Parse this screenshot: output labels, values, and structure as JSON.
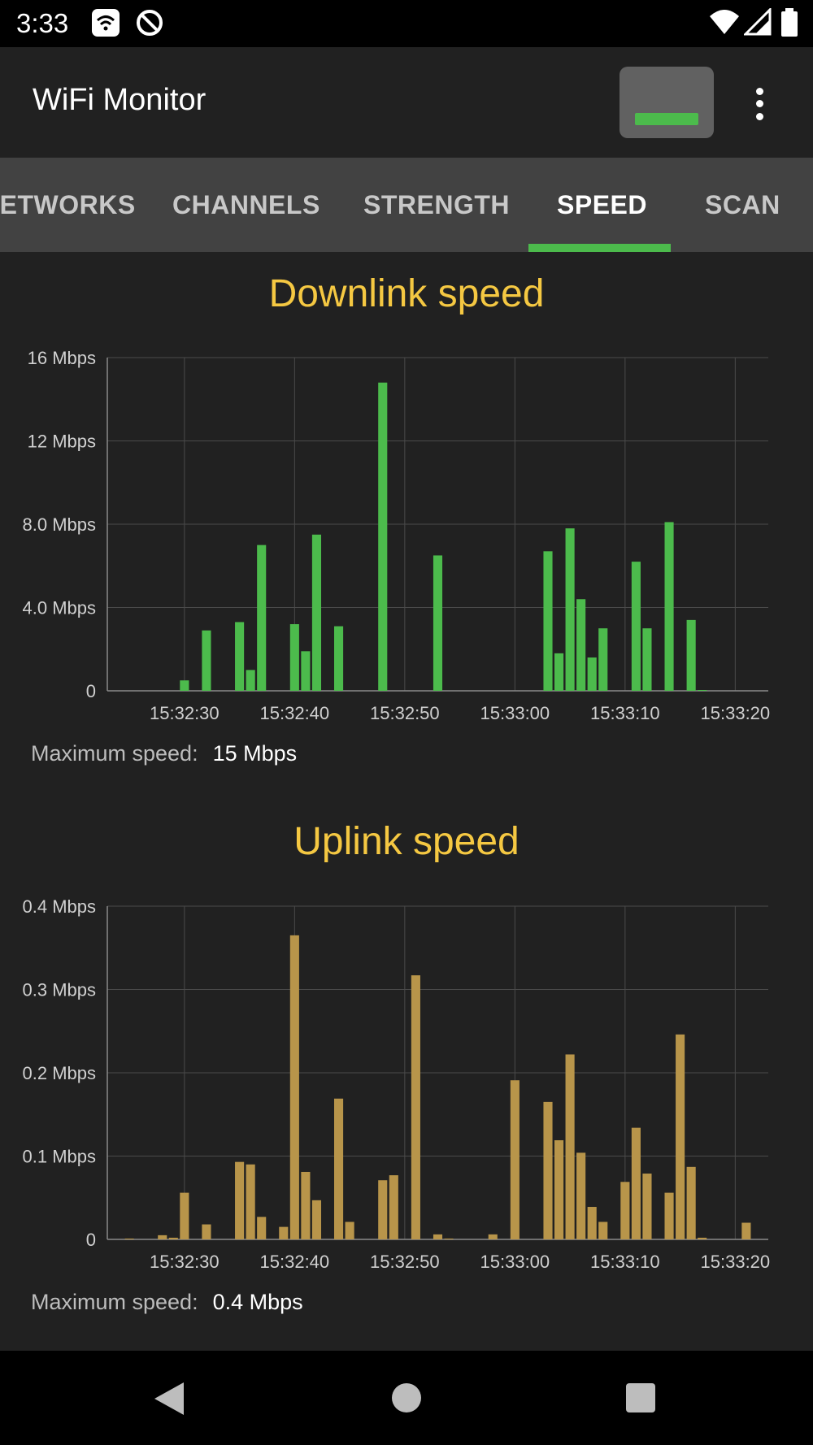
{
  "status_bar": {
    "time": "3:33",
    "left_icons": [
      "wifi-monitor-notification-icon",
      "do-not-disturb-icon"
    ],
    "right_icons": [
      "wifi-signal-icon",
      "cell-signal-icon",
      "battery-icon"
    ]
  },
  "app_bar": {
    "title": "WiFi Monitor",
    "status_button_icon": "connection-status-icon",
    "menu_icon": "more-vert-icon"
  },
  "tabs": [
    {
      "label": "NETWORKS",
      "active": false
    },
    {
      "label": "CHANNELS",
      "active": false
    },
    {
      "label": "STRENGTH",
      "active": false
    },
    {
      "label": "SPEED",
      "active": true
    },
    {
      "label": "SCAN",
      "active": false
    }
  ],
  "downlink": {
    "title": "Downlink speed",
    "max_label": "Maximum speed:",
    "max_value": "15 Mbps"
  },
  "uplink": {
    "title": "Uplink speed",
    "max_label": "Maximum speed:",
    "max_value": "0.4 Mbps"
  },
  "colors": {
    "downlink_bar": "#4cbb4c",
    "uplink_bar": "#b8954a",
    "title": "#f5c842",
    "tab_indicator": "#4cbb4c"
  },
  "chart_data": [
    {
      "type": "bar",
      "title": "Downlink speed",
      "xlabel": "",
      "ylabel": "",
      "ylim": [
        0,
        16
      ],
      "yticks": [
        0,
        4,
        8,
        12,
        16
      ],
      "ytick_labels": [
        "0",
        "4.0 Mbps",
        "8.0 Mbps",
        "12 Mbps",
        "16 Mbps"
      ],
      "xlim": [
        23,
        83
      ],
      "xticks": [
        30,
        40,
        50,
        60,
        70,
        80
      ],
      "xtick_labels": [
        "15:32:30",
        "15:32:40",
        "15:32:50",
        "15:33:00",
        "15:33:10",
        "15:33:20"
      ],
      "grid": true,
      "x": [
        30,
        32,
        35,
        36,
        37,
        40,
        41,
        42,
        44,
        48,
        53,
        63,
        64,
        65,
        66,
        67,
        68,
        71,
        72,
        74,
        76,
        77
      ],
      "values": [
        0.5,
        2.9,
        3.3,
        1.0,
        7.0,
        3.2,
        1.9,
        7.5,
        3.1,
        14.8,
        6.5,
        6.7,
        1.8,
        7.8,
        4.4,
        1.6,
        3.0,
        6.2,
        3.0,
        8.1,
        3.4,
        0.0
      ],
      "legend": "none"
    },
    {
      "type": "bar",
      "title": "Uplink speed",
      "xlabel": "",
      "ylabel": "",
      "ylim": [
        0,
        0.4
      ],
      "yticks": [
        0,
        0.1,
        0.2,
        0.3,
        0.4
      ],
      "ytick_labels": [
        "0",
        "0.1 Mbps",
        "0.2 Mbps",
        "0.3 Mbps",
        "0.4 Mbps"
      ],
      "xlim": [
        23,
        83
      ],
      "xticks": [
        30,
        40,
        50,
        60,
        70,
        80
      ],
      "xtick_labels": [
        "15:32:30",
        "15:32:40",
        "15:32:50",
        "15:33:00",
        "15:33:10",
        "15:33:20"
      ],
      "grid": true,
      "x": [
        25,
        28,
        29,
        30,
        32,
        35,
        36,
        37,
        39,
        40,
        41,
        42,
        44,
        45,
        48,
        49,
        51,
        53,
        54,
        58,
        60,
        63,
        64,
        65,
        66,
        67,
        68,
        70,
        71,
        72,
        74,
        75,
        76,
        77,
        81
      ],
      "values": [
        0.001,
        0.005,
        0.002,
        0.056,
        0.018,
        0.093,
        0.09,
        0.027,
        0.015,
        0.365,
        0.081,
        0.047,
        0.169,
        0.021,
        0.071,
        0.077,
        0.317,
        0.006,
        0.001,
        0.006,
        0.191,
        0.165,
        0.119,
        0.222,
        0.104,
        0.039,
        0.021,
        0.069,
        0.134,
        0.079,
        0.056,
        0.246,
        0.087,
        0.002,
        0.02
      ],
      "legend": "none"
    }
  ]
}
